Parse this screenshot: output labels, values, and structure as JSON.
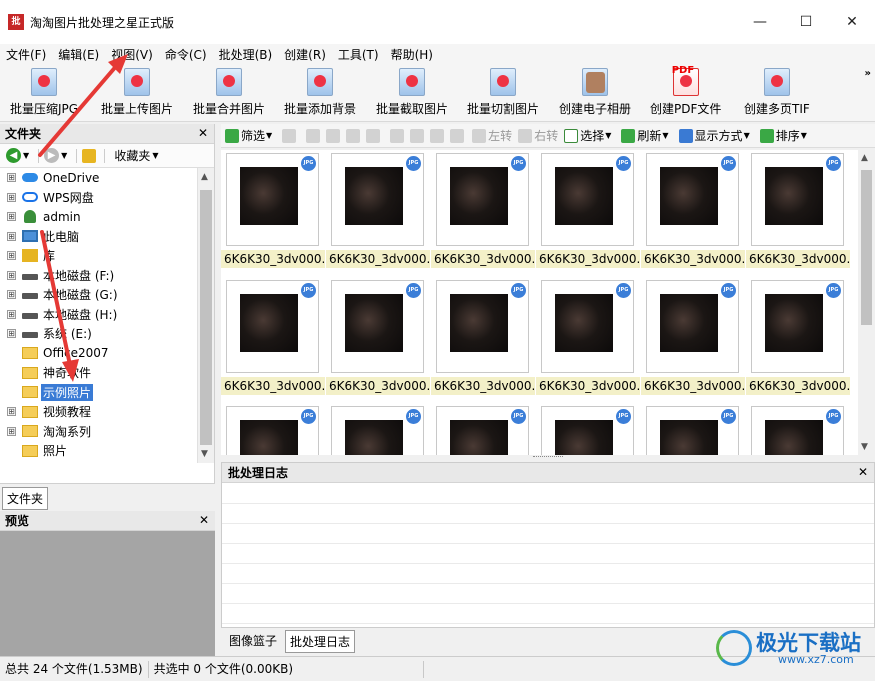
{
  "window": {
    "title": "淘淘图片批处理之星正式版",
    "app_icon_text": "批",
    "min_glyph": "—",
    "max_glyph": "☐",
    "close_glyph": "✕"
  },
  "menu": [
    "文件(F)",
    "编辑(E)",
    "视图(V)",
    "命令(C)",
    "批处理(B)",
    "创建(R)",
    "工具(T)",
    "帮助(H)"
  ],
  "big_toolbar": {
    "buttons": [
      "批量压缩JPG",
      "批量上传图片",
      "批量合并图片",
      "批量添加背景",
      "批量截取图片",
      "批量切割图片",
      "创建电子相册",
      "创建PDF文件",
      "创建多页TIF"
    ],
    "more_glyph": "»",
    "pdf_icon_text": "PDF"
  },
  "folder_panel": {
    "title": "文件夹",
    "favorites_label": "收藏夹",
    "tree": [
      {
        "label": "OneDrive",
        "icon": "cloud-icon",
        "expander": "⊞"
      },
      {
        "label": "WPS网盘",
        "icon": "wps-cloud-icon",
        "expander": "⊞"
      },
      {
        "label": "admin",
        "icon": "user-icon",
        "expander": "⊞"
      },
      {
        "label": "此电脑",
        "icon": "computer-icon",
        "expander": "⊞"
      },
      {
        "label": "库",
        "icon": "library-icon",
        "expander": "⊞"
      },
      {
        "label": "本地磁盘 (F:)",
        "icon": "drive-icon",
        "expander": "⊞"
      },
      {
        "label": "本地磁盘 (G:)",
        "icon": "drive-icon",
        "expander": "⊞"
      },
      {
        "label": "本地磁盘 (H:)",
        "icon": "drive-icon",
        "expander": "⊞"
      },
      {
        "label": "系统 (E:)",
        "icon": "drive-icon",
        "expander": "⊞"
      },
      {
        "label": "Office2007",
        "icon": "folder-icon",
        "expander": ""
      },
      {
        "label": "神奇软件",
        "icon": "folder-icon",
        "expander": ""
      },
      {
        "label": "示例照片",
        "icon": "folder-icon",
        "expander": "",
        "selected": true
      },
      {
        "label": "视频教程",
        "icon": "folder-icon",
        "expander": "⊞"
      },
      {
        "label": "淘淘系列",
        "icon": "folder-icon",
        "expander": "⊞"
      },
      {
        "label": "照片",
        "icon": "folder-icon",
        "expander": ""
      }
    ],
    "tab_label": "文件夹"
  },
  "preview_panel": {
    "title": "预览"
  },
  "right_toolbar": {
    "filter": "筛选",
    "rotate_left": "左转",
    "rotate_right": "右转",
    "select": "选择",
    "refresh": "刷新",
    "display_mode": "显示方式",
    "sort": "排序"
  },
  "thumbnails": {
    "badge": "JPG",
    "label": "6K6K30_3dv000..."
  },
  "log_panel": {
    "title": "批处理日志"
  },
  "bottom_tabs": [
    "图像篮子",
    "批处理日志"
  ],
  "status": {
    "total": "总共 24 个文件(1.53MB)",
    "selected": "共选中 0 个文件(0.00KB)"
  },
  "watermark": {
    "title": "极光下载站",
    "url": "www.xz7.com"
  },
  "colors": {
    "accent": "#3a7bd5",
    "annotation_arrow": "#e53935",
    "thumb_label_bg": "#f3f0c8"
  }
}
